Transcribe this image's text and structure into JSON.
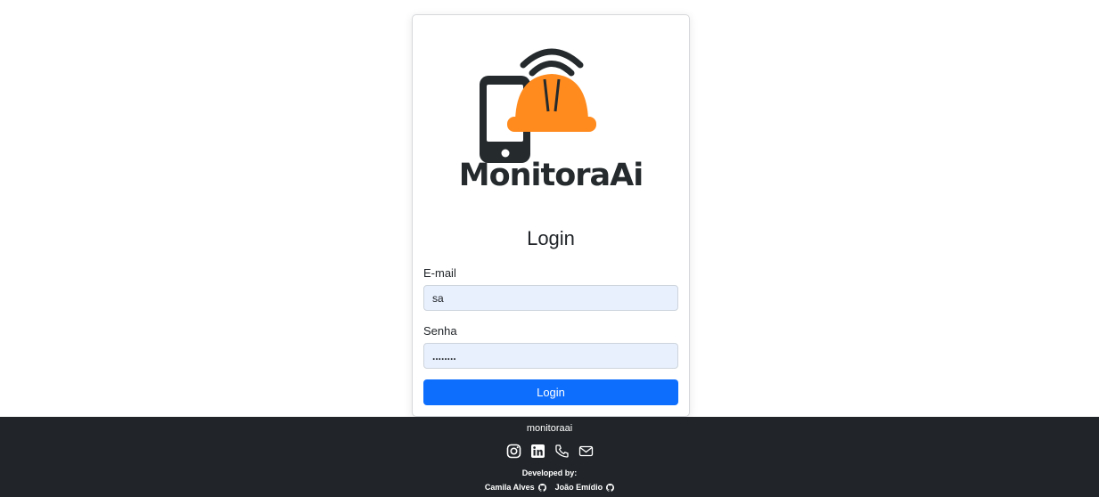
{
  "login": {
    "brand": "MonitoraAi",
    "title": "Login",
    "email_label": "E-mail",
    "email_value": "sa",
    "password_label": "Senha",
    "password_value": "........",
    "submit_label": "Login"
  },
  "footer": {
    "brand": "monitoraai",
    "developed_by": "Developed by:",
    "developers": [
      "Camila Alves",
      "João Emídio"
    ]
  },
  "icons": {
    "instagram": "instagram-icon",
    "linkedin": "linkedin-icon",
    "phone": "phone-icon",
    "mail": "mail-icon",
    "github": "github-icon"
  },
  "colors": {
    "accent": "#0d6efd",
    "footer_bg": "#212529",
    "helmet_orange": "#ff8b1f",
    "logo_dark": "#252a2d",
    "input_bg": "#e8f0fe"
  }
}
